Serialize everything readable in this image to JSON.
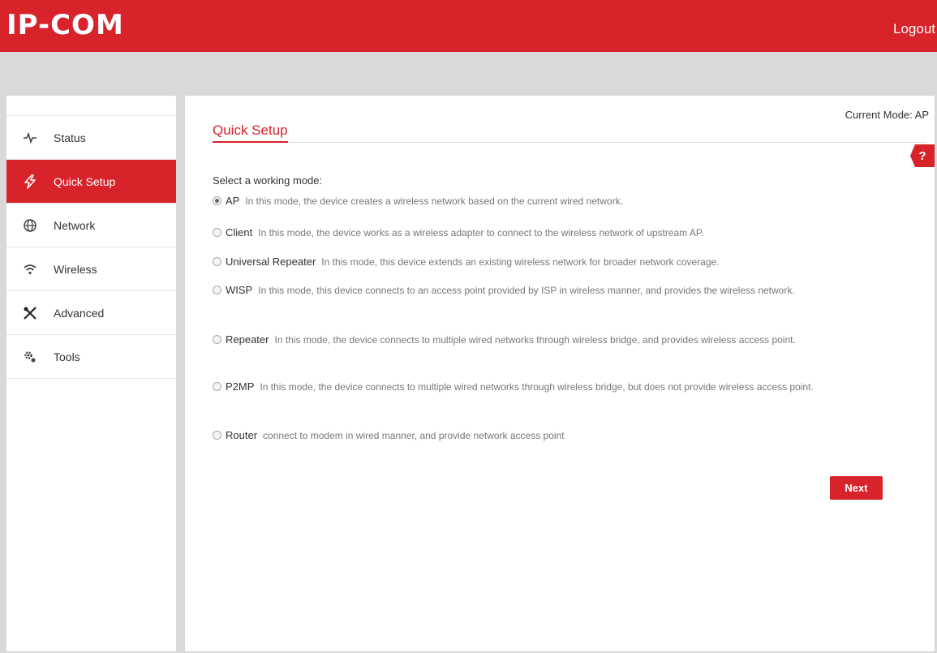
{
  "header": {
    "logo": "IP-COM",
    "logout": "Logout"
  },
  "sidebar": {
    "items": [
      {
        "label": "Status",
        "icon": "pulse-icon"
      },
      {
        "label": "Quick Setup",
        "icon": "bolt-icon",
        "active": true
      },
      {
        "label": "Network",
        "icon": "globe-icon"
      },
      {
        "label": "Wireless",
        "icon": "wifi-icon"
      },
      {
        "label": "Advanced",
        "icon": "tools-cross-icon"
      },
      {
        "label": "Tools",
        "icon": "gears-icon"
      }
    ]
  },
  "main": {
    "current_mode": "Current Mode: AP",
    "title": "Quick Setup",
    "help": "?",
    "select_label": "Select a working mode:",
    "modes": [
      {
        "name": "AP",
        "desc": "In this mode, the device creates a wireless network based on the current wired network.",
        "checked": true
      },
      {
        "name": "Client",
        "desc": "In this mode, the device works as a wireless adapter to connect to the wireless network of upstream AP."
      },
      {
        "name": "Universal Repeater",
        "desc": "In this mode, this device extends an existing wireless network for broader network coverage."
      },
      {
        "name": "WISP",
        "desc": "In this mode, this device connects to an access point provided by ISP in wireless manner, and provides the wireless network."
      },
      {
        "name": "Repeater",
        "desc": "In this mode, the device connects to multiple wired networks through wireless bridge, and provides wireless access point."
      },
      {
        "name": "P2MP",
        "desc": "In this mode, the device connects to multiple wired networks through wireless bridge, but does not provide wireless access point."
      },
      {
        "name": "Router",
        "desc": "connect to modem in wired manner, and provide network access point"
      }
    ],
    "next_label": "Next"
  },
  "colors": {
    "brand_red": "#d8232a",
    "background": "#d9d9d9"
  }
}
